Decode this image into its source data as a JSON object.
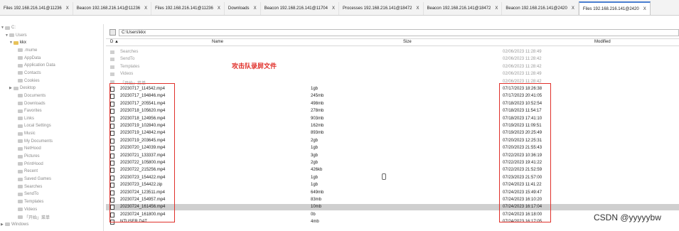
{
  "tabs": [
    {
      "label": "Files 192.168.216.141@11236",
      "close": "X",
      "active": false
    },
    {
      "label": "Beacon 192.168.216.141@11236",
      "close": "X",
      "active": false
    },
    {
      "label": "Files 192.168.216.141@11236",
      "close": "X",
      "active": false
    },
    {
      "label": "Downloads",
      "close": "X",
      "active": false
    },
    {
      "label": "Beacon 192.168.216.141@11704",
      "close": "X",
      "active": false
    },
    {
      "label": "Processes 192.168.216.141@18472",
      "close": "X",
      "active": false
    },
    {
      "label": "Beacon 192.168.216.141@18472",
      "close": "X",
      "active": false
    },
    {
      "label": "Beacon 192.168.216.141@2420",
      "close": "X",
      "active": false
    },
    {
      "label": "Files 192.168.216.141@2420",
      "close": "X",
      "active": true
    }
  ],
  "tree": [
    {
      "label": "C:",
      "exp": "▼",
      "strong": false,
      "open": false
    },
    {
      "label": "Users",
      "exp": "▼",
      "strong": false,
      "open": false
    },
    {
      "label": "kkx",
      "exp": "▼",
      "strong": true,
      "open": true
    },
    {
      "label": ".mume",
      "exp": "",
      "strong": false,
      "open": false
    },
    {
      "label": "AppData",
      "exp": "",
      "strong": false,
      "open": false
    },
    {
      "label": "Application Data",
      "exp": "",
      "strong": false,
      "open": false
    },
    {
      "label": "Contacts",
      "exp": "",
      "strong": false,
      "open": false
    },
    {
      "label": "Cookies",
      "exp": "",
      "strong": false,
      "open": false
    },
    {
      "label": "Desktop",
      "exp": "▶",
      "strong": false,
      "open": false
    },
    {
      "label": "Documents",
      "exp": "",
      "strong": false,
      "open": false
    },
    {
      "label": "Downloads",
      "exp": "",
      "strong": false,
      "open": false
    },
    {
      "label": "Favorites",
      "exp": "",
      "strong": false,
      "open": false
    },
    {
      "label": "Links",
      "exp": "",
      "strong": false,
      "open": false
    },
    {
      "label": "Local Settings",
      "exp": "",
      "strong": false,
      "open": false
    },
    {
      "label": "Music",
      "exp": "",
      "strong": false,
      "open": false
    },
    {
      "label": "My Documents",
      "exp": "",
      "strong": false,
      "open": false
    },
    {
      "label": "NetHood",
      "exp": "",
      "strong": false,
      "open": false
    },
    {
      "label": "Pictures",
      "exp": "",
      "strong": false,
      "open": false
    },
    {
      "label": "PrintHood",
      "exp": "",
      "strong": false,
      "open": false
    },
    {
      "label": "Recent",
      "exp": "",
      "strong": false,
      "open": false
    },
    {
      "label": "Saved Games",
      "exp": "",
      "strong": false,
      "open": false
    },
    {
      "label": "Searches",
      "exp": "",
      "strong": false,
      "open": false
    },
    {
      "label": "SendTo",
      "exp": "",
      "strong": false,
      "open": false
    },
    {
      "label": "Templates",
      "exp": "",
      "strong": false,
      "open": false
    },
    {
      "label": "Videos",
      "exp": "",
      "strong": false,
      "open": false
    },
    {
      "label": "「开始」菜单",
      "exp": "",
      "strong": false,
      "open": false
    },
    {
      "label": "Windows",
      "exp": "▶",
      "strong": false,
      "open": false
    }
  ],
  "path": "C:\\Users\\kkx",
  "columns": {
    "d": "D",
    "name": "Name",
    "size": "Size",
    "modified": "Modified"
  },
  "rows": [
    {
      "type": "folder",
      "name": "Searches",
      "size": "",
      "modified": "02/06/2023 11:28:49",
      "sel": false
    },
    {
      "type": "folder",
      "name": "SendTo",
      "size": "",
      "modified": "02/06/2023 11:28:42",
      "sel": false
    },
    {
      "type": "folder",
      "name": "Templates",
      "size": "",
      "modified": "02/06/2023 11:28:42",
      "sel": false
    },
    {
      "type": "folder",
      "name": "Videos",
      "size": "",
      "modified": "02/06/2023 11:28:49",
      "sel": false
    },
    {
      "type": "folder",
      "name": "「开始」菜单",
      "size": "",
      "modified": "02/06/2023 11:28:42",
      "sel": false
    },
    {
      "type": "file",
      "name": "20230717_114542.mp4",
      "size": "1gb",
      "modified": "07/17/2023 18:26:38",
      "sel": false
    },
    {
      "type": "file",
      "name": "20230717_194846.mp4",
      "size": "245mb",
      "modified": "07/17/2023 20:41:05",
      "sel": false
    },
    {
      "type": "file",
      "name": "20230717_205541.mp4",
      "size": "498mb",
      "modified": "07/18/2023 10:52:54",
      "sel": false
    },
    {
      "type": "file",
      "name": "20230718_105620.mp4",
      "size": "278mb",
      "modified": "07/18/2023 11:54:17",
      "sel": false
    },
    {
      "type": "file",
      "name": "20230718_124956.mp4",
      "size": "903mb",
      "modified": "07/18/2023 17:41:10",
      "sel": false
    },
    {
      "type": "file",
      "name": "20230719_102840.mp4",
      "size": "162mb",
      "modified": "07/19/2023 11:09:51",
      "sel": false
    },
    {
      "type": "file",
      "name": "20230719_124842.mp4",
      "size": "893mb",
      "modified": "07/19/2023 20:25:49",
      "sel": false
    },
    {
      "type": "file",
      "name": "20230719_203645.mp4",
      "size": "2gb",
      "modified": "07/20/2023 12:25:31",
      "sel": false
    },
    {
      "type": "file",
      "name": "20230720_124039.mp4",
      "size": "1gb",
      "modified": "07/20/2023 21:55:43",
      "sel": false
    },
    {
      "type": "file",
      "name": "20230721_133337.mp4",
      "size": "3gb",
      "modified": "07/22/2023 10:36:19",
      "sel": false
    },
    {
      "type": "file",
      "name": "20230722_105800.mp4",
      "size": "2gb",
      "modified": "07/22/2023 19:41:22",
      "sel": false
    },
    {
      "type": "file",
      "name": "20230722_215256.mp4",
      "size": "426kb",
      "modified": "07/22/2023 21:52:59",
      "sel": false
    },
    {
      "type": "file",
      "name": "20230723_154422.mp4",
      "size": "1gb",
      "modified": "07/23/2023 21:57:00",
      "sel": false
    },
    {
      "type": "file",
      "name": "20230723_154422.zip",
      "size": "1gb",
      "modified": "07/24/2023 11:41:22",
      "sel": false
    },
    {
      "type": "file",
      "name": "20230724_123511.mp4",
      "size": "649mb",
      "modified": "07/24/2023 15:49:47",
      "sel": false
    },
    {
      "type": "file",
      "name": "20230724_154957.mp4",
      "size": "83mb",
      "modified": "07/24/2023 16:10:20",
      "sel": false
    },
    {
      "type": "file",
      "name": "20230724_161456.mp4",
      "size": "10mb",
      "modified": "07/24/2023 16:17:04",
      "sel": true
    },
    {
      "type": "file",
      "name": "20230724_161800.mp4",
      "size": "0b",
      "modified": "07/24/2023 16:18:00",
      "sel": false
    },
    {
      "type": "file",
      "name": "NTUSER.DAT",
      "size": "4mb",
      "modified": "07/24/2023 16:17:05",
      "sel": false
    }
  ],
  "annotation": "攻击队录屏文件",
  "watermark": "CSDN @yyyyybw",
  "colors": {
    "annotation": "#e0302a",
    "active_tab": "#4a7fd0",
    "selected_row": "#cfcfcf"
  }
}
